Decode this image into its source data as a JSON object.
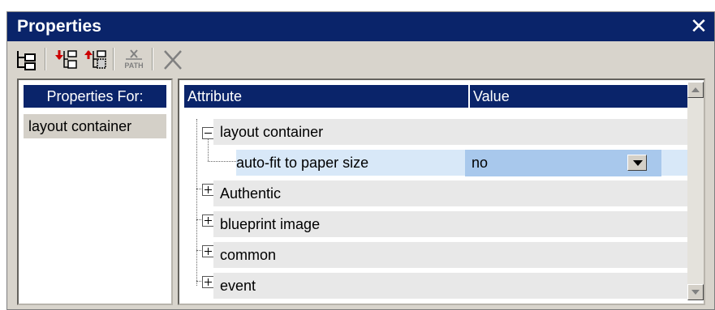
{
  "window": {
    "title": "Properties",
    "close_symbol": "✕"
  },
  "toolbar": {
    "buttons": [
      {
        "icon": "tree-view-icon"
      },
      {
        "icon": "insert-before-icon"
      },
      {
        "icon": "append-icon"
      },
      {
        "icon": "xpath-icon",
        "label": "PATH"
      },
      {
        "icon": "delete-icon"
      }
    ]
  },
  "properties_for": {
    "header": "Properties For:",
    "items": [
      "layout container"
    ]
  },
  "grid": {
    "columns": {
      "attribute": "Attribute",
      "value": "Value"
    },
    "groups": [
      {
        "label": "layout container",
        "expanded": true,
        "children": [
          {
            "attribute": "auto-fit to paper size",
            "value": "no"
          }
        ]
      },
      {
        "label": "Authentic",
        "expanded": false
      },
      {
        "label": "blueprint image",
        "expanded": false
      },
      {
        "label": "common",
        "expanded": false
      },
      {
        "label": "event",
        "expanded": false
      }
    ]
  },
  "colors": {
    "title_bar": "#0a246a",
    "selected_value": "#a8c8ec",
    "panel_bg": "#d8d4cc"
  }
}
